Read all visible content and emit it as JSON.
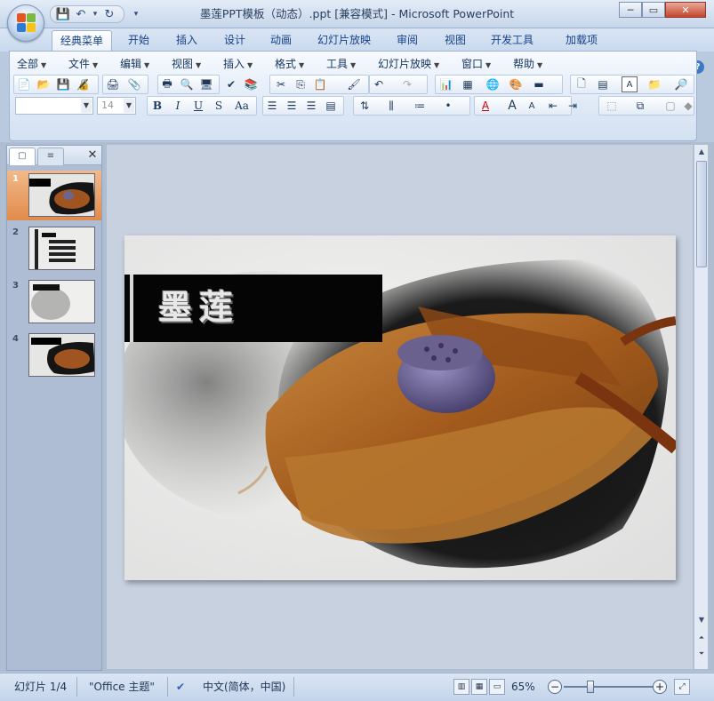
{
  "window": {
    "title": "墨莲PPT模板（动态）.ppt [兼容模式] - Microsoft PowerPoint",
    "minimize": "─",
    "restore": "▭",
    "close": "✕"
  },
  "qat": {
    "save": "💾",
    "undo": "↶",
    "redo": "↻",
    "more": "▾"
  },
  "ribbon_tabs": [
    "经典菜单",
    "开始",
    "插入",
    "设计",
    "动画",
    "幻灯片放映",
    "审阅",
    "视图",
    "开发工具",
    "加载项"
  ],
  "active_tab": "经典菜单",
  "help": "?",
  "menus": [
    "全部",
    "文件",
    "编辑",
    "视图",
    "插入",
    "格式",
    "工具",
    "幻灯片放映",
    "窗口",
    "帮助"
  ],
  "toolbar": {
    "font_name_value": "",
    "font_size_value": "14",
    "bold": "B",
    "italic": "I",
    "underline": "U",
    "shadow": "S",
    "change_case": "Aa"
  },
  "panel": {
    "tab_slides": "▢",
    "tab_outline": "≡",
    "close": "✕"
  },
  "slides": [
    {
      "number": "1",
      "selected": true
    },
    {
      "number": "2",
      "selected": false
    },
    {
      "number": "3",
      "selected": false
    },
    {
      "number": "4",
      "selected": false
    }
  ],
  "slide": {
    "title": "墨莲"
  },
  "status": {
    "slide_counter": "幻灯片 1/4",
    "theme": "\"Office 主题\"",
    "language": "中文(简体，中国)",
    "zoom": "65%",
    "zoom_out": "−",
    "zoom_in": "+"
  },
  "colors": {
    "accent": "#e28b4a",
    "ribbon": "#dfe9f6",
    "title_text": "#15428b"
  }
}
